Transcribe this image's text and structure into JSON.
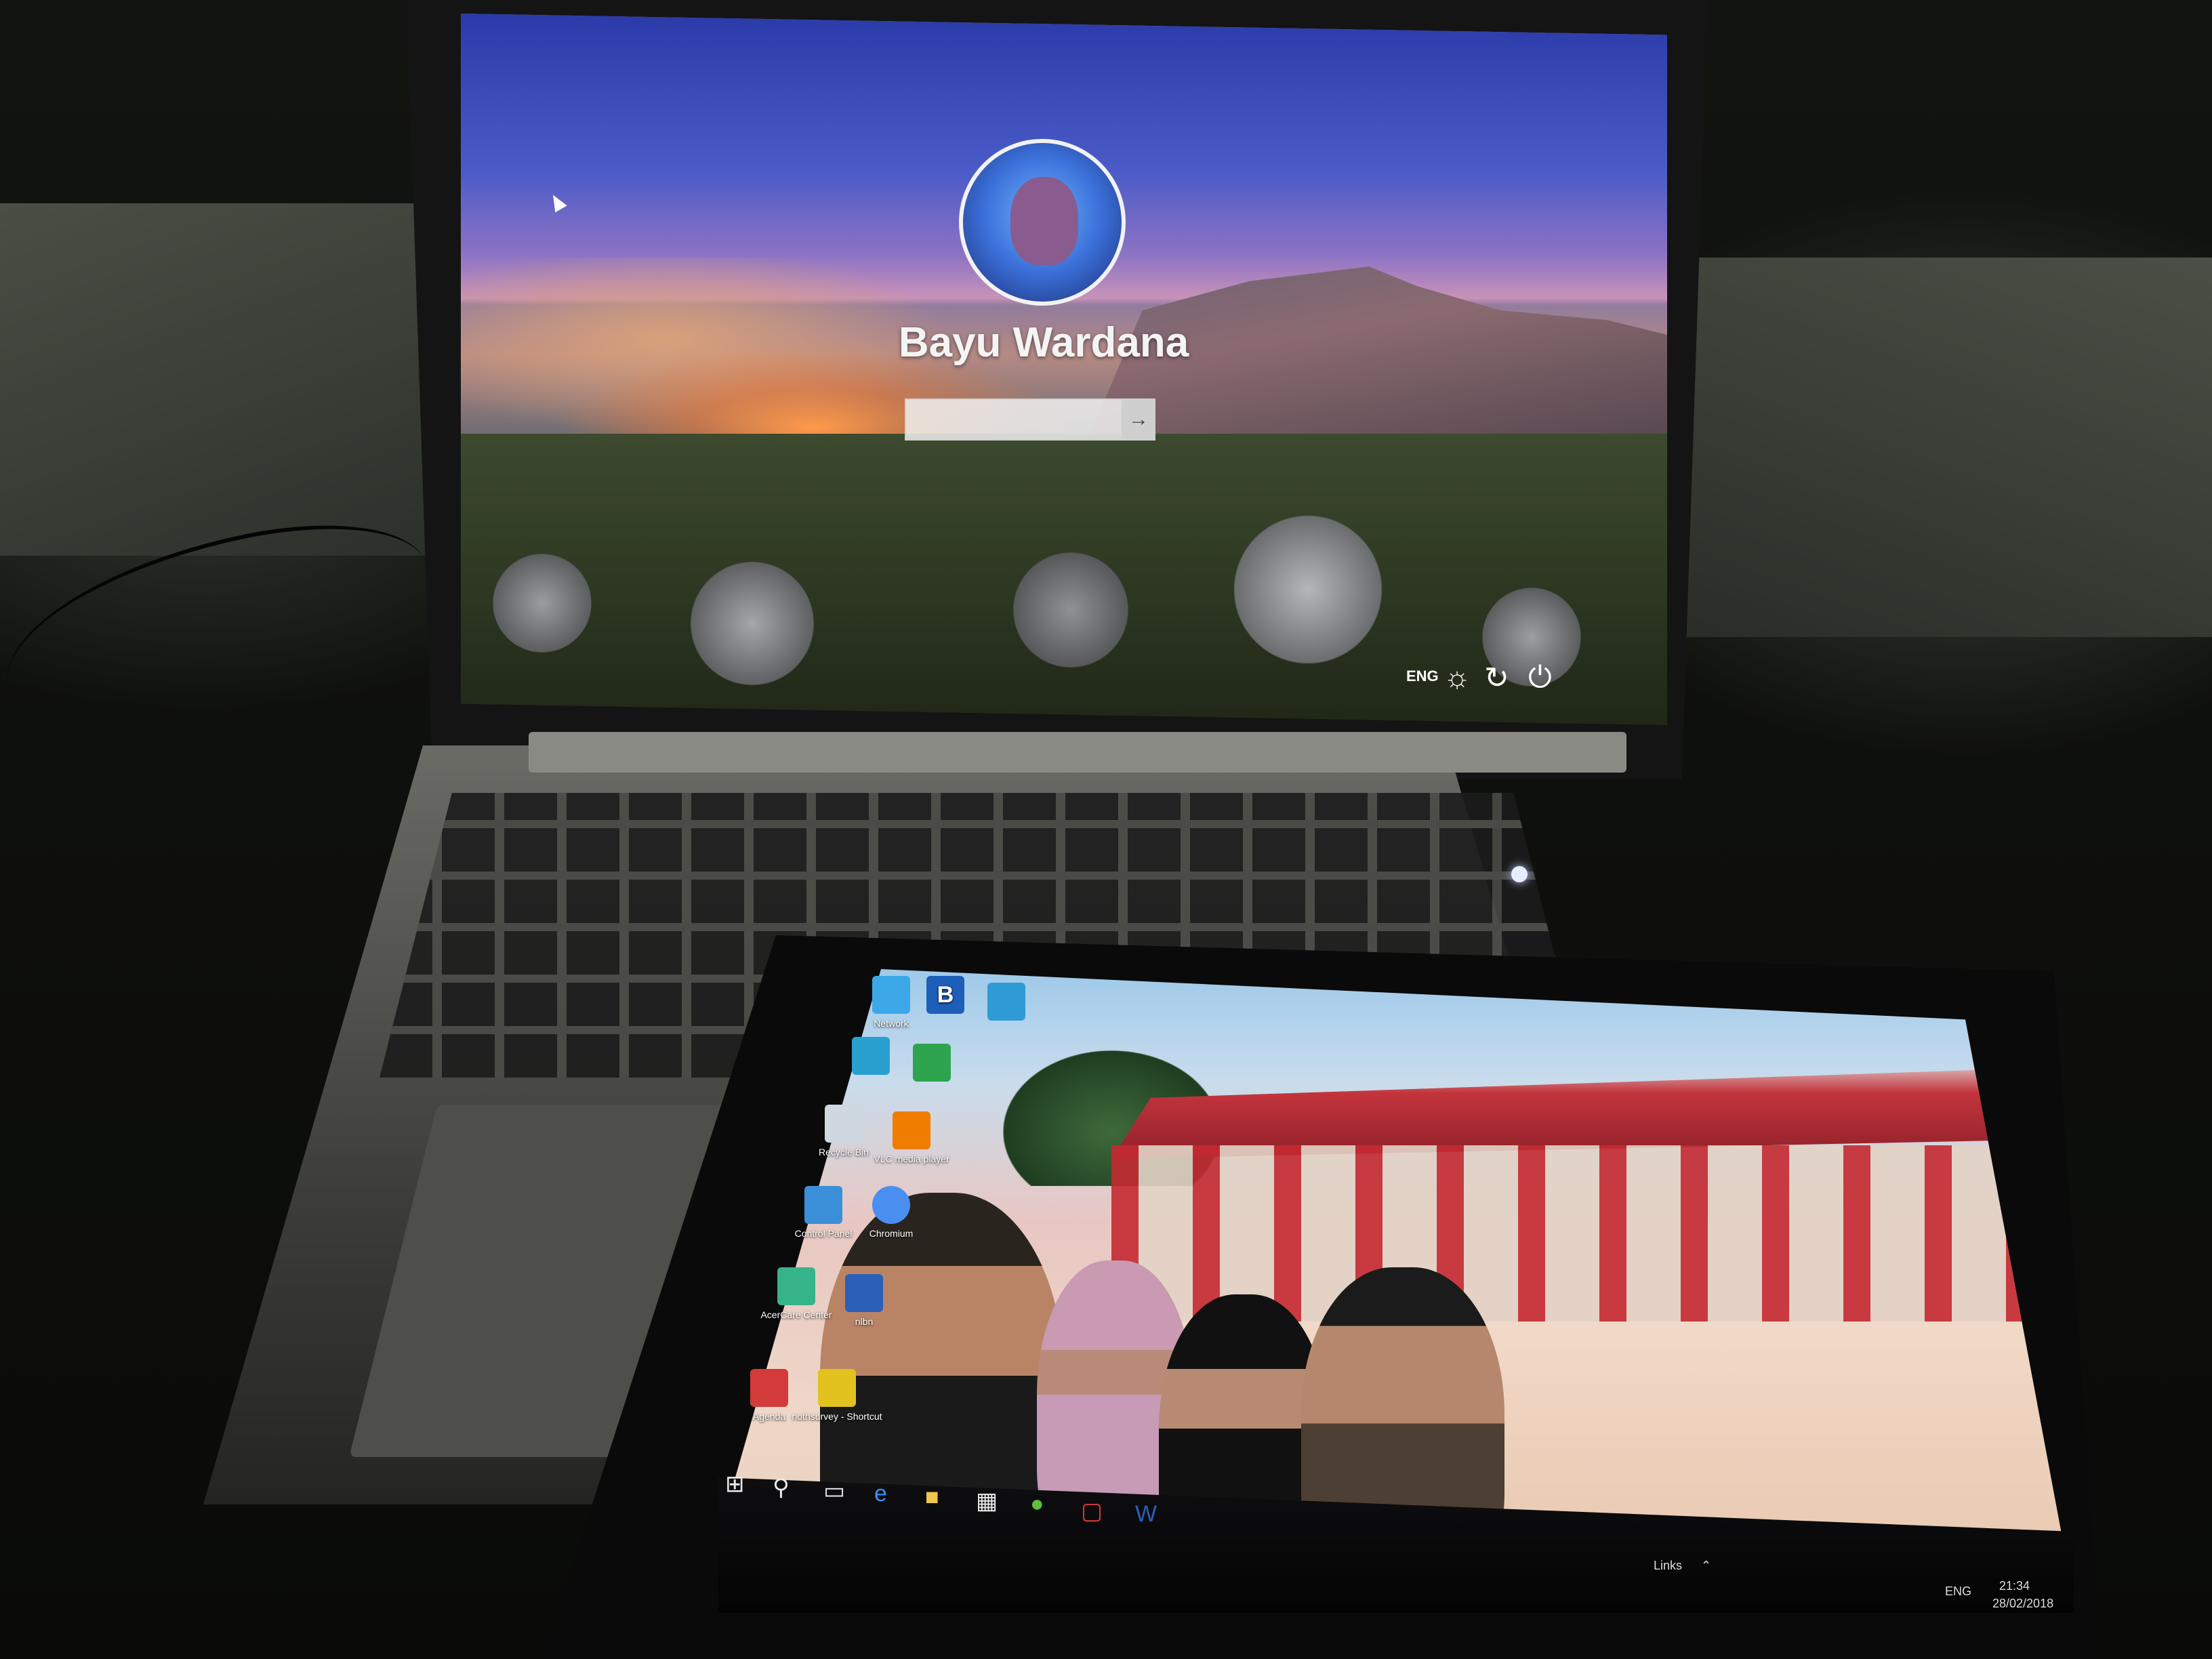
{
  "laptop_lock_screen": {
    "user_name": "Bayu Wardana",
    "password_submit_icon": "arrow-right-icon",
    "language_indicator": "ENG",
    "corner_icons": [
      "network-icon",
      "ease-of-access-icon",
      "power-icon"
    ]
  },
  "tablet_desktop": {
    "desktop_icons": [
      {
        "label": "Network",
        "icon": "network-icon",
        "color": "#3ca8e8"
      },
      {
        "label": "B",
        "icon": "b-app-icon",
        "color": "#1d5fb8"
      },
      {
        "label": "",
        "icon": "app-icon",
        "color": "#2f9bd6"
      },
      {
        "label": "",
        "icon": "app-icon",
        "color": "#29a0d0"
      },
      {
        "label": "",
        "icon": "app-icon",
        "color": "#2ea44f"
      },
      {
        "label": "Recycle Bin",
        "icon": "recycle-bin-icon",
        "color": "#cfd8e0"
      },
      {
        "label": "VLC media player",
        "icon": "vlc-icon",
        "color": "#f07c00"
      },
      {
        "label": "Control Panel",
        "icon": "control-panel-icon",
        "color": "#3b8fd8"
      },
      {
        "label": "Chromium",
        "icon": "chromium-icon",
        "color": "#4a8ff0"
      },
      {
        "label": "AcerCare Center",
        "icon": "acer-care-icon",
        "color": "#37b38a"
      },
      {
        "label": "nlbn",
        "icon": "word-doc-icon",
        "color": "#2b5fb8"
      },
      {
        "label": "Agenda",
        "icon": "calendar-icon",
        "color": "#d33a3a"
      },
      {
        "label": "nothsurvey - Shortcut",
        "icon": "shortcut-icon",
        "color": "#e2c21f"
      }
    ],
    "taskbar": {
      "pinned": [
        "start-icon",
        "search-icon",
        "task-view-icon",
        "edge-icon",
        "file-explorer-icon",
        "store-icon",
        "app-icon",
        "office-icon",
        "word-icon"
      ],
      "links_label": "Links",
      "language": "ENG",
      "time": "21:34",
      "date": "28/02/2018"
    }
  }
}
